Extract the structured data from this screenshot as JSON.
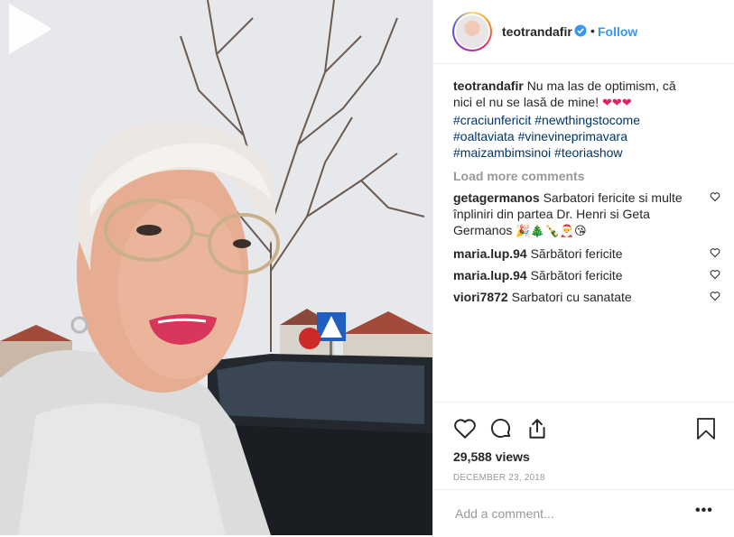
{
  "post": {
    "username": "teotrandafir",
    "follow_label": "Follow",
    "dot": "•",
    "caption": {
      "text": "Nu ma las de optimism, că nici el nu se lasă de mine!",
      "emojis": "❤❤❤",
      "hashtags": [
        "#craciunfericit",
        "#newthingstocome",
        "#oaltaviata",
        "#vinevineprimavara",
        "#maizambimsinoi",
        "#teoriashow"
      ]
    },
    "load_more": "Load more comments",
    "comments": [
      {
        "user": "getagermanos",
        "text": "Sarbatori fericite si multe înpliniri din partea Dr. Henri si Geta Germanos",
        "emojis": "🎉🎄🍾🎅😘"
      },
      {
        "user": "maria.lup.94",
        "text": "Sărbători fericite"
      },
      {
        "user": "maria.lup.94",
        "text": "Sărbători fericite"
      },
      {
        "user": "viori7872",
        "text": "Sarbatori cu sanatate"
      }
    ],
    "views": "29,588 views",
    "date": "DECEMBER 23, 2018",
    "add_comment_placeholder": "Add a comment...",
    "more_options": "•••"
  },
  "icons": {
    "like": "heart-icon",
    "comment": "comment-icon",
    "share": "share-icon",
    "save": "bookmark-icon",
    "play": "play-icon",
    "verified": "verified-badge-icon"
  },
  "colors": {
    "link": "#3897f0",
    "hashtag": "#003569",
    "muted": "#999999",
    "heart": "#e0245e"
  }
}
